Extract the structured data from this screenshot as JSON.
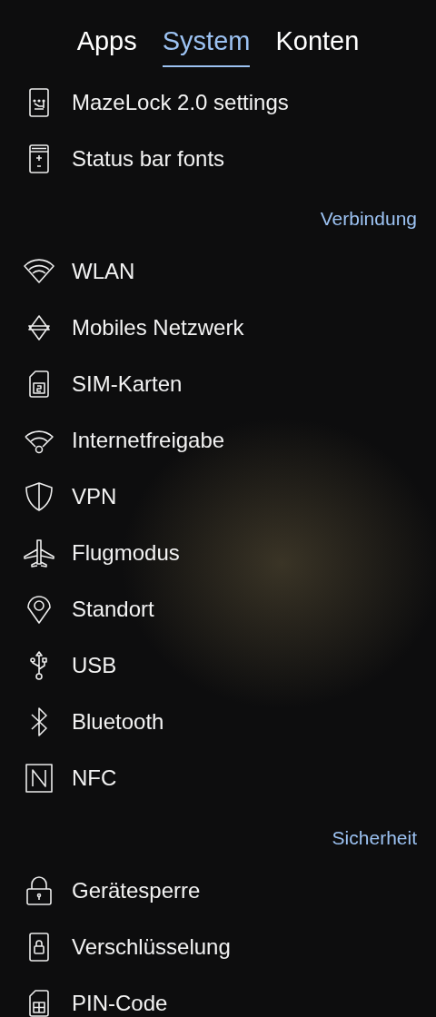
{
  "tabs": [
    {
      "label": "Apps",
      "selected": false
    },
    {
      "label": "System",
      "selected": true
    },
    {
      "label": "Konten",
      "selected": false
    }
  ],
  "sections": [
    {
      "items": [
        {
          "label": "MazeLock 2.0 settings",
          "kind": "pattern"
        },
        {
          "label": "Status bar fonts",
          "kind": "statusbar"
        }
      ]
    },
    {
      "header": "Verbindung",
      "items": [
        {
          "label": "WLAN",
          "kind": "wifi"
        },
        {
          "label": "Mobiles Netzwerk",
          "kind": "mobile"
        },
        {
          "label": "SIM-Karten",
          "kind": "sim"
        },
        {
          "label": "Internetfreigabe",
          "kind": "hotspot"
        },
        {
          "label": "VPN",
          "kind": "shield"
        },
        {
          "label": "Flugmodus",
          "kind": "plane"
        },
        {
          "label": "Standort",
          "kind": "pin"
        },
        {
          "label": "USB",
          "kind": "usb"
        },
        {
          "label": "Bluetooth",
          "kind": "bluetooth"
        },
        {
          "label": "NFC",
          "kind": "nfc"
        }
      ]
    },
    {
      "header": "Sicherheit",
      "items": [
        {
          "label": "Gerätesperre",
          "kind": "lock"
        },
        {
          "label": "Verschlüsselung",
          "kind": "encrypt"
        },
        {
          "label": "PIN-Code",
          "kind": "pincode"
        }
      ]
    }
  ]
}
